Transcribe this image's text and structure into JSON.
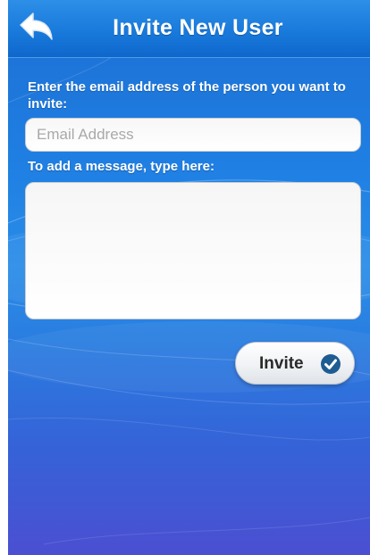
{
  "header": {
    "title": "Invite New User",
    "back_icon": "back-arrow-icon"
  },
  "form": {
    "email_prompt": "Enter the email address of the person you want to invite:",
    "email_placeholder": "Email Address",
    "email_value": "",
    "message_prompt": "To add a message, type here:",
    "message_value": ""
  },
  "actions": {
    "invite_label": "Invite",
    "invite_icon": "checkmark-circle-icon"
  },
  "colors": {
    "background_top": "#1d6fd3",
    "background_bottom": "#4b4fd2",
    "header": "#197adc",
    "check_circle": "#1f5c92"
  }
}
